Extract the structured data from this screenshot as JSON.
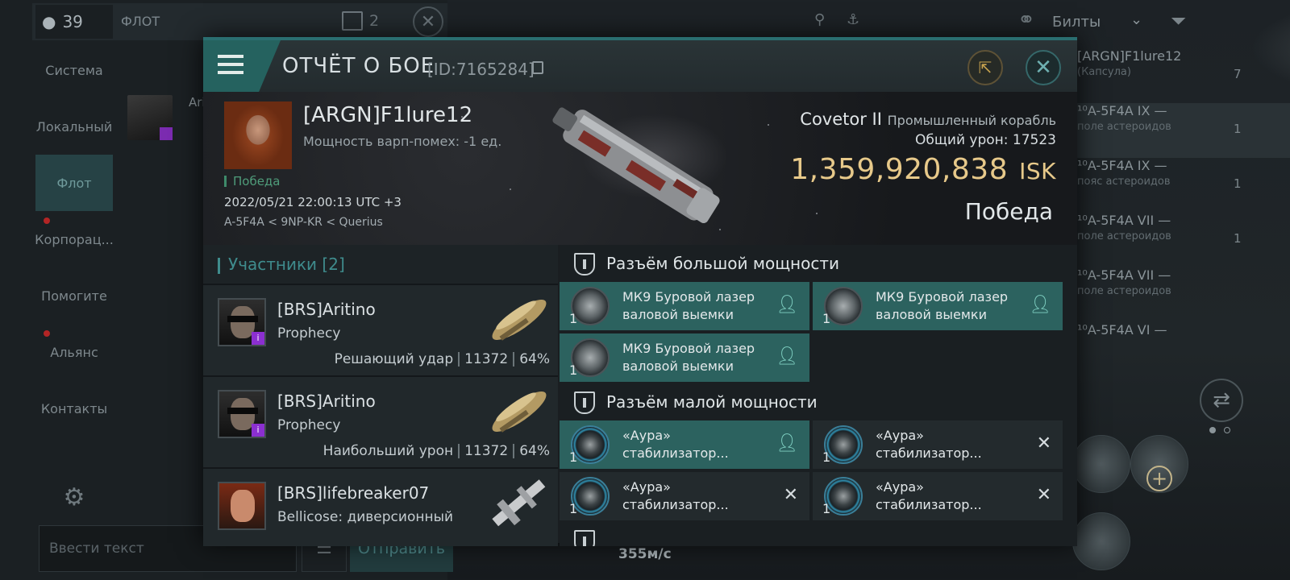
{
  "chat": {
    "member_count": "39",
    "title": "ФЛОТ",
    "channel_count": "2",
    "nav": [
      {
        "label": "Система",
        "active": false,
        "alert": false
      },
      {
        "label": "Локальный",
        "active": false,
        "alert": false
      },
      {
        "label": "Флот",
        "active": true,
        "alert": false
      },
      {
        "label": "Корпорац...",
        "active": false,
        "alert": true
      },
      {
        "label": "Помогите",
        "active": false,
        "alert": false
      },
      {
        "label": "Альянс",
        "active": false,
        "alert": true
      },
      {
        "label": "Контакты",
        "active": false,
        "alert": false
      }
    ],
    "fleet_member_name": "Ari",
    "input_placeholder": "Ввести текст",
    "send_label": "Отправить"
  },
  "topbar": {
    "builds_label": "Билты"
  },
  "overview": {
    "items": [
      {
        "name": "[ARGN]F1lure12",
        "sub": "(Капсула)",
        "count": "7",
        "selected": false
      },
      {
        "name": "¹⁰A-5F4A IX —",
        "sub": "поле астероидов",
        "count": "1",
        "selected": true
      },
      {
        "name": "¹⁰A-5F4A IX —",
        "sub": "пояс астероидов",
        "count": "1",
        "selected": false
      },
      {
        "name": "¹⁰A-5F4A VII —",
        "sub": "поле астероидов",
        "count": "1",
        "selected": false
      },
      {
        "name": "¹⁰A-5F4A VII —",
        "sub": "поле астероидов",
        "count": "",
        "selected": false
      },
      {
        "name": "¹⁰A-5F4A VI —",
        "sub": "",
        "count": "",
        "selected": false
      }
    ]
  },
  "hud": {
    "speed": "355м/с"
  },
  "report": {
    "title": "ОТЧЁТ О БОЕ",
    "id": "[ID:7165284]",
    "victim": {
      "name": "[ARGN]F1lure12",
      "warp_strength": "Мощность варп-помех: -1 ед.",
      "result": "Победа",
      "datetime": "2022/05/21 22:00:13 UTC +3",
      "location": "A-5F4A < 9NP-KR < Querius",
      "ship": "Covetor II",
      "ship_class": "Промышленный корабль",
      "total_damage_label": "Общий урон:",
      "total_damage": "17523",
      "isk_value": "1,359,920,838",
      "isk_unit": "ISK",
      "outcome": "Победа"
    },
    "participants": {
      "header": "Участники",
      "count": "[2]",
      "rows": [
        {
          "name": "[BRS]Aritino",
          "ship": "Prophecy",
          "role": "Решающий удар",
          "damage": "11372",
          "percent": "64%"
        },
        {
          "name": "[BRS]Aritino",
          "ship": "Prophecy",
          "role": "Наибольший урон",
          "damage": "11372",
          "percent": "64%"
        },
        {
          "name": "[BRS]lifebreaker07",
          "ship": "Bellicose: диверсионный",
          "role": "",
          "damage": "",
          "percent": ""
        }
      ]
    },
    "fitting": {
      "high_slot_label": "Разъём большой мощности",
      "low_slot_label": "Разъём малой мощности",
      "high_slots": [
        {
          "qty": "1",
          "name": "МК9 Буровой лазер валовой выемки",
          "status": "dropped"
        },
        {
          "qty": "1",
          "name": "МК9 Буровой лазер валовой выемки",
          "status": "dropped"
        },
        {
          "qty": "1",
          "name": "МК9 Буровой лазер валовой выемки",
          "status": "dropped"
        }
      ],
      "low_slots": [
        {
          "qty": "1",
          "name": "«Аура» стабилизатор...",
          "status": "dropped"
        },
        {
          "qty": "1",
          "name": "«Аура» стабилизатор...",
          "status": "destroyed"
        },
        {
          "qty": "1",
          "name": "«Аура» стабилизатор...",
          "status": "destroyed"
        },
        {
          "qty": "1",
          "name": "«Аура» стабилизатор...",
          "status": "destroyed"
        }
      ]
    }
  }
}
